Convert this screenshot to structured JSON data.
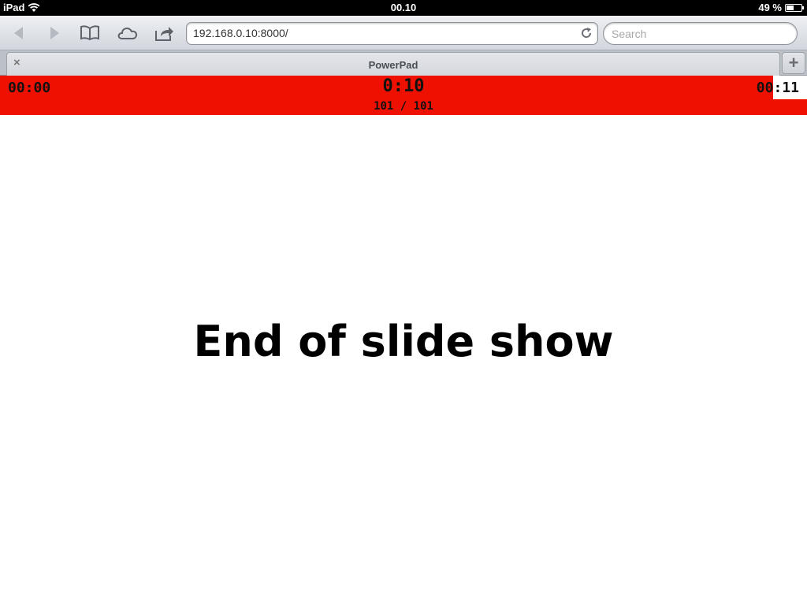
{
  "status_bar": {
    "device": "iPad",
    "time": "00.10",
    "battery": "49 %",
    "battery_level": 0.49
  },
  "toolbar": {
    "url": "192.168.0.10:8000/",
    "search_placeholder": "Search"
  },
  "tabs": {
    "active_title": "PowerPad",
    "close_label": "×",
    "new_tab_label": "+"
  },
  "presenter": {
    "elapsed": "00:00",
    "slide_timer": "0:10",
    "slide_counter": "101 / 101",
    "clock_hours": "00",
    "clock_minutes": ":11",
    "bar_color": "#ee1000"
  },
  "slide": {
    "message": "End of slide show"
  }
}
